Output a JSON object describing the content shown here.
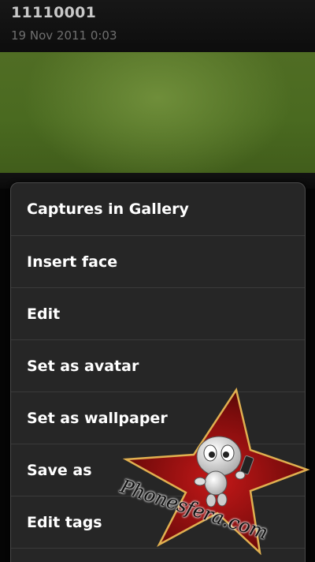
{
  "header": {
    "title": "11110001",
    "subtitle": "19 Nov 2011 0:03"
  },
  "menu": {
    "items": [
      {
        "label": "Captures in Gallery"
      },
      {
        "label": "Insert face"
      },
      {
        "label": "Edit"
      },
      {
        "label": "Set as avatar"
      },
      {
        "label": "Set as wallpaper"
      },
      {
        "label": "Save as"
      },
      {
        "label": "Edit tags"
      }
    ]
  },
  "watermark": {
    "text": "Phonesfera.com",
    "icon": "star-mascot-logo"
  },
  "colors": {
    "menu_background": "#262626",
    "menu_text": "#ffffff",
    "photo_green": "#4f6c23",
    "star_red": "#8a1010"
  }
}
